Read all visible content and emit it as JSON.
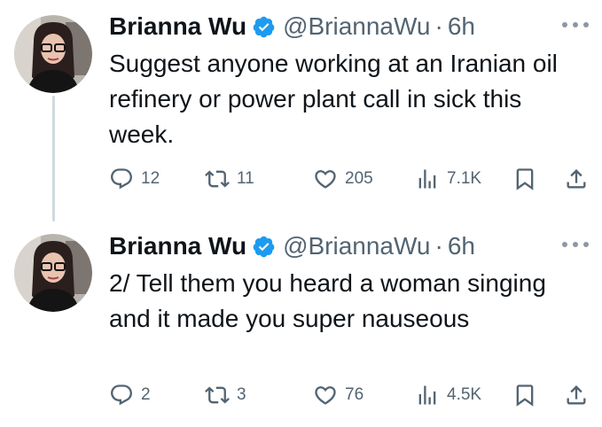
{
  "tweets": [
    {
      "author_name": "Brianna Wu",
      "handle": "@BriannaWu",
      "separator": "·",
      "time": "6h",
      "text": "Suggest anyone working at an Iranian oil refinery or power plant call in sick this week.",
      "replies": "12",
      "retweets": "11",
      "likes": "205",
      "views": "7.1K"
    },
    {
      "author_name": "Brianna Wu",
      "handle": "@BriannaWu",
      "separator": "·",
      "time": "6h",
      "text": "2/ Tell them you heard a woman singing and it made you super nauseous",
      "replies": "2",
      "retweets": "3",
      "likes": "76",
      "views": "4.5K"
    }
  ],
  "colors": {
    "text": "#0f1419",
    "secondary": "#536471",
    "verified": "#1d9bf0",
    "thread_line": "#cfd9de"
  },
  "icons": [
    "verified-badge-icon",
    "more-icon",
    "reply-icon",
    "retweet-icon",
    "like-icon",
    "views-icon",
    "bookmark-icon",
    "share-icon"
  ]
}
